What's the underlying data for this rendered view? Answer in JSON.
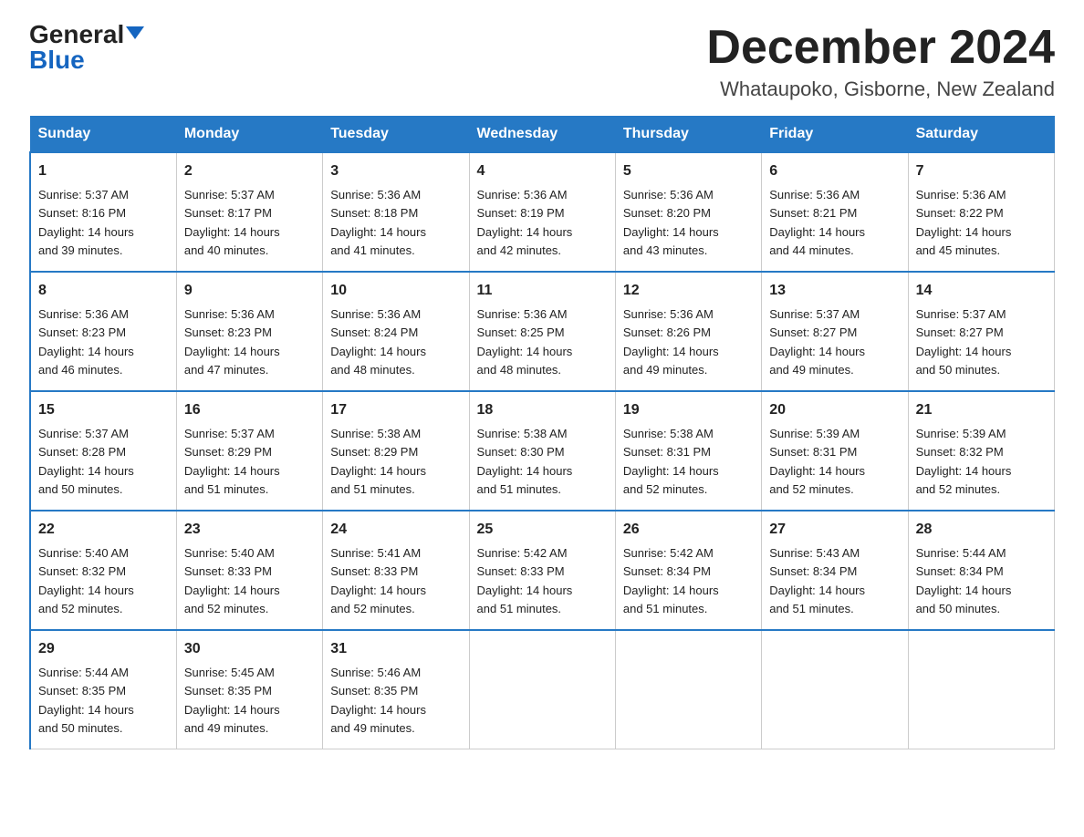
{
  "header": {
    "logo_line1": "General",
    "logo_line2": "Blue",
    "month": "December 2024",
    "location": "Whataupoko, Gisborne, New Zealand"
  },
  "weekdays": [
    "Sunday",
    "Monday",
    "Tuesday",
    "Wednesday",
    "Thursday",
    "Friday",
    "Saturday"
  ],
  "weeks": [
    [
      {
        "day": "1",
        "sunrise": "5:37 AM",
        "sunset": "8:16 PM",
        "daylight": "14 hours and 39 minutes."
      },
      {
        "day": "2",
        "sunrise": "5:37 AM",
        "sunset": "8:17 PM",
        "daylight": "14 hours and 40 minutes."
      },
      {
        "day": "3",
        "sunrise": "5:36 AM",
        "sunset": "8:18 PM",
        "daylight": "14 hours and 41 minutes."
      },
      {
        "day": "4",
        "sunrise": "5:36 AM",
        "sunset": "8:19 PM",
        "daylight": "14 hours and 42 minutes."
      },
      {
        "day": "5",
        "sunrise": "5:36 AM",
        "sunset": "8:20 PM",
        "daylight": "14 hours and 43 minutes."
      },
      {
        "day": "6",
        "sunrise": "5:36 AM",
        "sunset": "8:21 PM",
        "daylight": "14 hours and 44 minutes."
      },
      {
        "day": "7",
        "sunrise": "5:36 AM",
        "sunset": "8:22 PM",
        "daylight": "14 hours and 45 minutes."
      }
    ],
    [
      {
        "day": "8",
        "sunrise": "5:36 AM",
        "sunset": "8:23 PM",
        "daylight": "14 hours and 46 minutes."
      },
      {
        "day": "9",
        "sunrise": "5:36 AM",
        "sunset": "8:23 PM",
        "daylight": "14 hours and 47 minutes."
      },
      {
        "day": "10",
        "sunrise": "5:36 AM",
        "sunset": "8:24 PM",
        "daylight": "14 hours and 48 minutes."
      },
      {
        "day": "11",
        "sunrise": "5:36 AM",
        "sunset": "8:25 PM",
        "daylight": "14 hours and 48 minutes."
      },
      {
        "day": "12",
        "sunrise": "5:36 AM",
        "sunset": "8:26 PM",
        "daylight": "14 hours and 49 minutes."
      },
      {
        "day": "13",
        "sunrise": "5:37 AM",
        "sunset": "8:27 PM",
        "daylight": "14 hours and 49 minutes."
      },
      {
        "day": "14",
        "sunrise": "5:37 AM",
        "sunset": "8:27 PM",
        "daylight": "14 hours and 50 minutes."
      }
    ],
    [
      {
        "day": "15",
        "sunrise": "5:37 AM",
        "sunset": "8:28 PM",
        "daylight": "14 hours and 50 minutes."
      },
      {
        "day": "16",
        "sunrise": "5:37 AM",
        "sunset": "8:29 PM",
        "daylight": "14 hours and 51 minutes."
      },
      {
        "day": "17",
        "sunrise": "5:38 AM",
        "sunset": "8:29 PM",
        "daylight": "14 hours and 51 minutes."
      },
      {
        "day": "18",
        "sunrise": "5:38 AM",
        "sunset": "8:30 PM",
        "daylight": "14 hours and 51 minutes."
      },
      {
        "day": "19",
        "sunrise": "5:38 AM",
        "sunset": "8:31 PM",
        "daylight": "14 hours and 52 minutes."
      },
      {
        "day": "20",
        "sunrise": "5:39 AM",
        "sunset": "8:31 PM",
        "daylight": "14 hours and 52 minutes."
      },
      {
        "day": "21",
        "sunrise": "5:39 AM",
        "sunset": "8:32 PM",
        "daylight": "14 hours and 52 minutes."
      }
    ],
    [
      {
        "day": "22",
        "sunrise": "5:40 AM",
        "sunset": "8:32 PM",
        "daylight": "14 hours and 52 minutes."
      },
      {
        "day": "23",
        "sunrise": "5:40 AM",
        "sunset": "8:33 PM",
        "daylight": "14 hours and 52 minutes."
      },
      {
        "day": "24",
        "sunrise": "5:41 AM",
        "sunset": "8:33 PM",
        "daylight": "14 hours and 52 minutes."
      },
      {
        "day": "25",
        "sunrise": "5:42 AM",
        "sunset": "8:33 PM",
        "daylight": "14 hours and 51 minutes."
      },
      {
        "day": "26",
        "sunrise": "5:42 AM",
        "sunset": "8:34 PM",
        "daylight": "14 hours and 51 minutes."
      },
      {
        "day": "27",
        "sunrise": "5:43 AM",
        "sunset": "8:34 PM",
        "daylight": "14 hours and 51 minutes."
      },
      {
        "day": "28",
        "sunrise": "5:44 AM",
        "sunset": "8:34 PM",
        "daylight": "14 hours and 50 minutes."
      }
    ],
    [
      {
        "day": "29",
        "sunrise": "5:44 AM",
        "sunset": "8:35 PM",
        "daylight": "14 hours and 50 minutes."
      },
      {
        "day": "30",
        "sunrise": "5:45 AM",
        "sunset": "8:35 PM",
        "daylight": "14 hours and 49 minutes."
      },
      {
        "day": "31",
        "sunrise": "5:46 AM",
        "sunset": "8:35 PM",
        "daylight": "14 hours and 49 minutes."
      },
      null,
      null,
      null,
      null
    ]
  ],
  "labels": {
    "sunrise": "Sunrise:",
    "sunset": "Sunset:",
    "daylight": "Daylight:"
  }
}
